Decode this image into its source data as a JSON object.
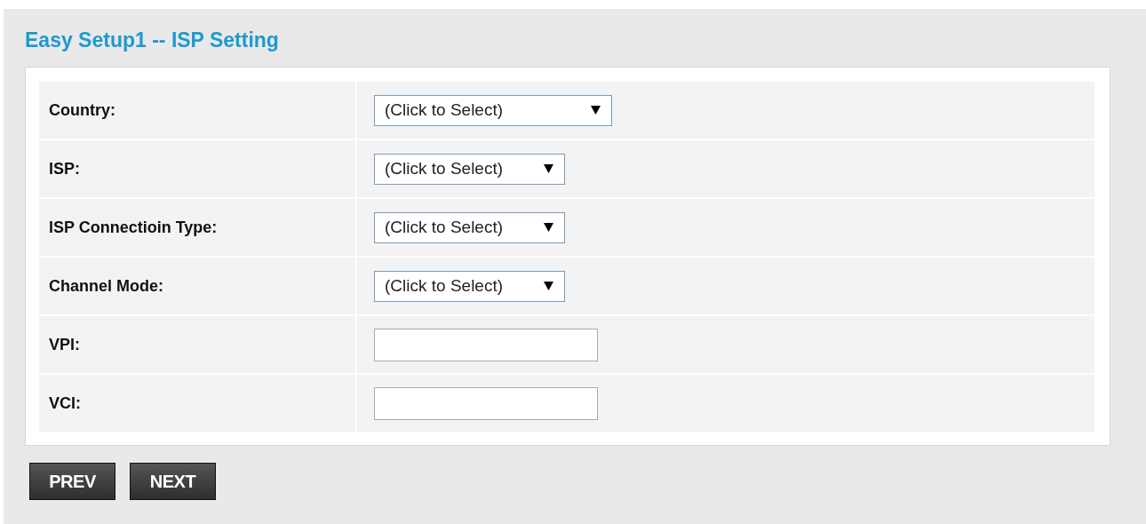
{
  "title": "Easy Setup1 -- ISP Setting",
  "rows": [
    {
      "label": "Country:",
      "kind": "select",
      "value": "(Click to Select)",
      "wide": true
    },
    {
      "label": "ISP:",
      "kind": "select",
      "value": "(Click to Select)",
      "wide": false
    },
    {
      "label": "ISP Connectioin Type:",
      "kind": "select",
      "value": "(Click to Select)",
      "wide": false
    },
    {
      "label": "Channel Mode:",
      "kind": "select",
      "value": "(Click to Select)",
      "wide": false
    },
    {
      "label": "VPI:",
      "kind": "text"
    },
    {
      "label": "VCI:",
      "kind": "text"
    }
  ],
  "buttons": [
    "PREV",
    "NEXT"
  ]
}
